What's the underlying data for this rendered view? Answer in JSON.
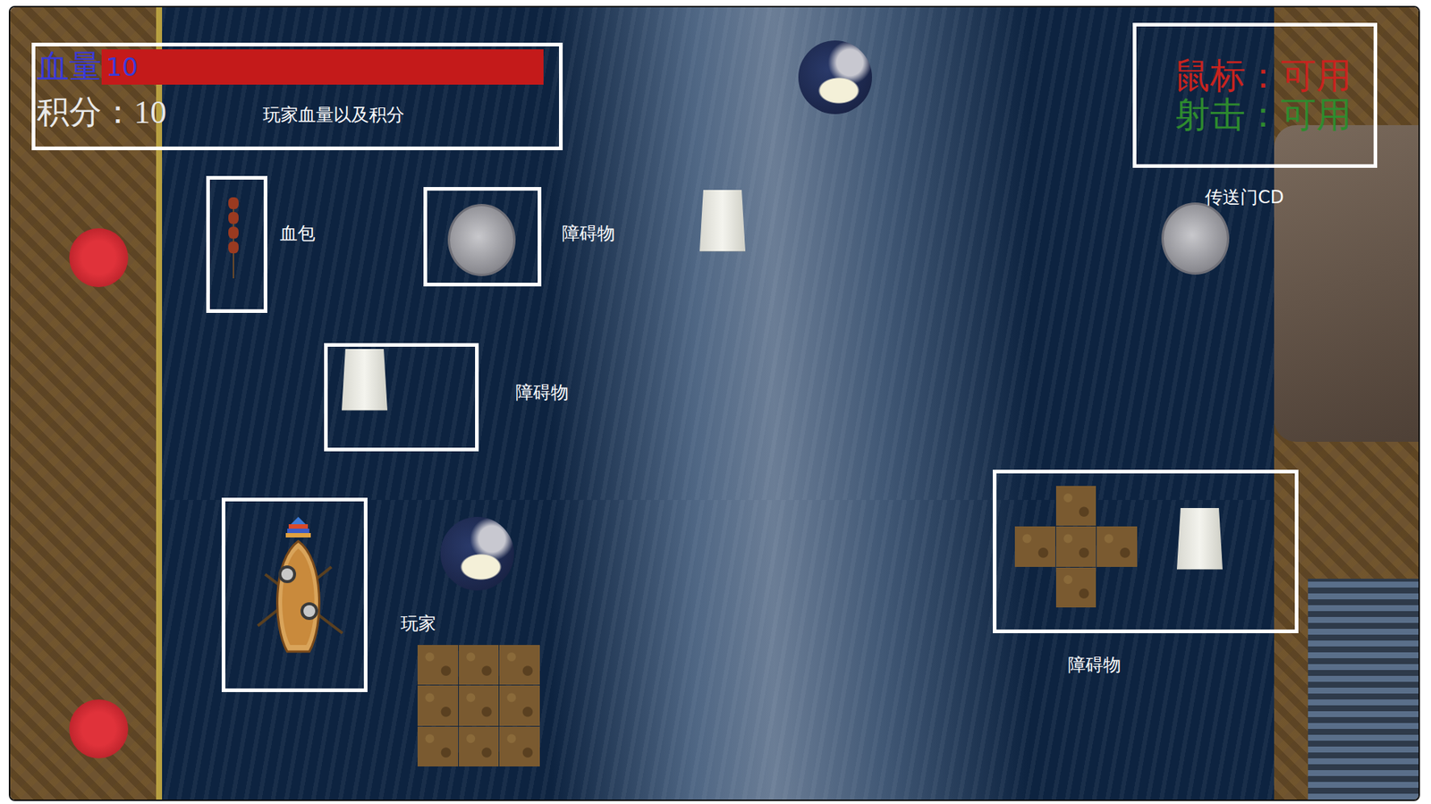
{
  "hud": {
    "hp_label": "血量",
    "hp": "10",
    "hp_level": 1,
    "score_label": "积分：",
    "score": "10"
  },
  "status": [
    {
      "label": "鼠标：",
      "value": "可用",
      "color": "#c8231e"
    },
    {
      "label": "射击：",
      "value": "可用",
      "color": "#2e8b2e"
    }
  ],
  "annotations": [
    "玩家血量以及积分",
    "血包",
    "障碍物",
    "障碍物",
    "玩家",
    "障碍物",
    "传送门CD"
  ]
}
